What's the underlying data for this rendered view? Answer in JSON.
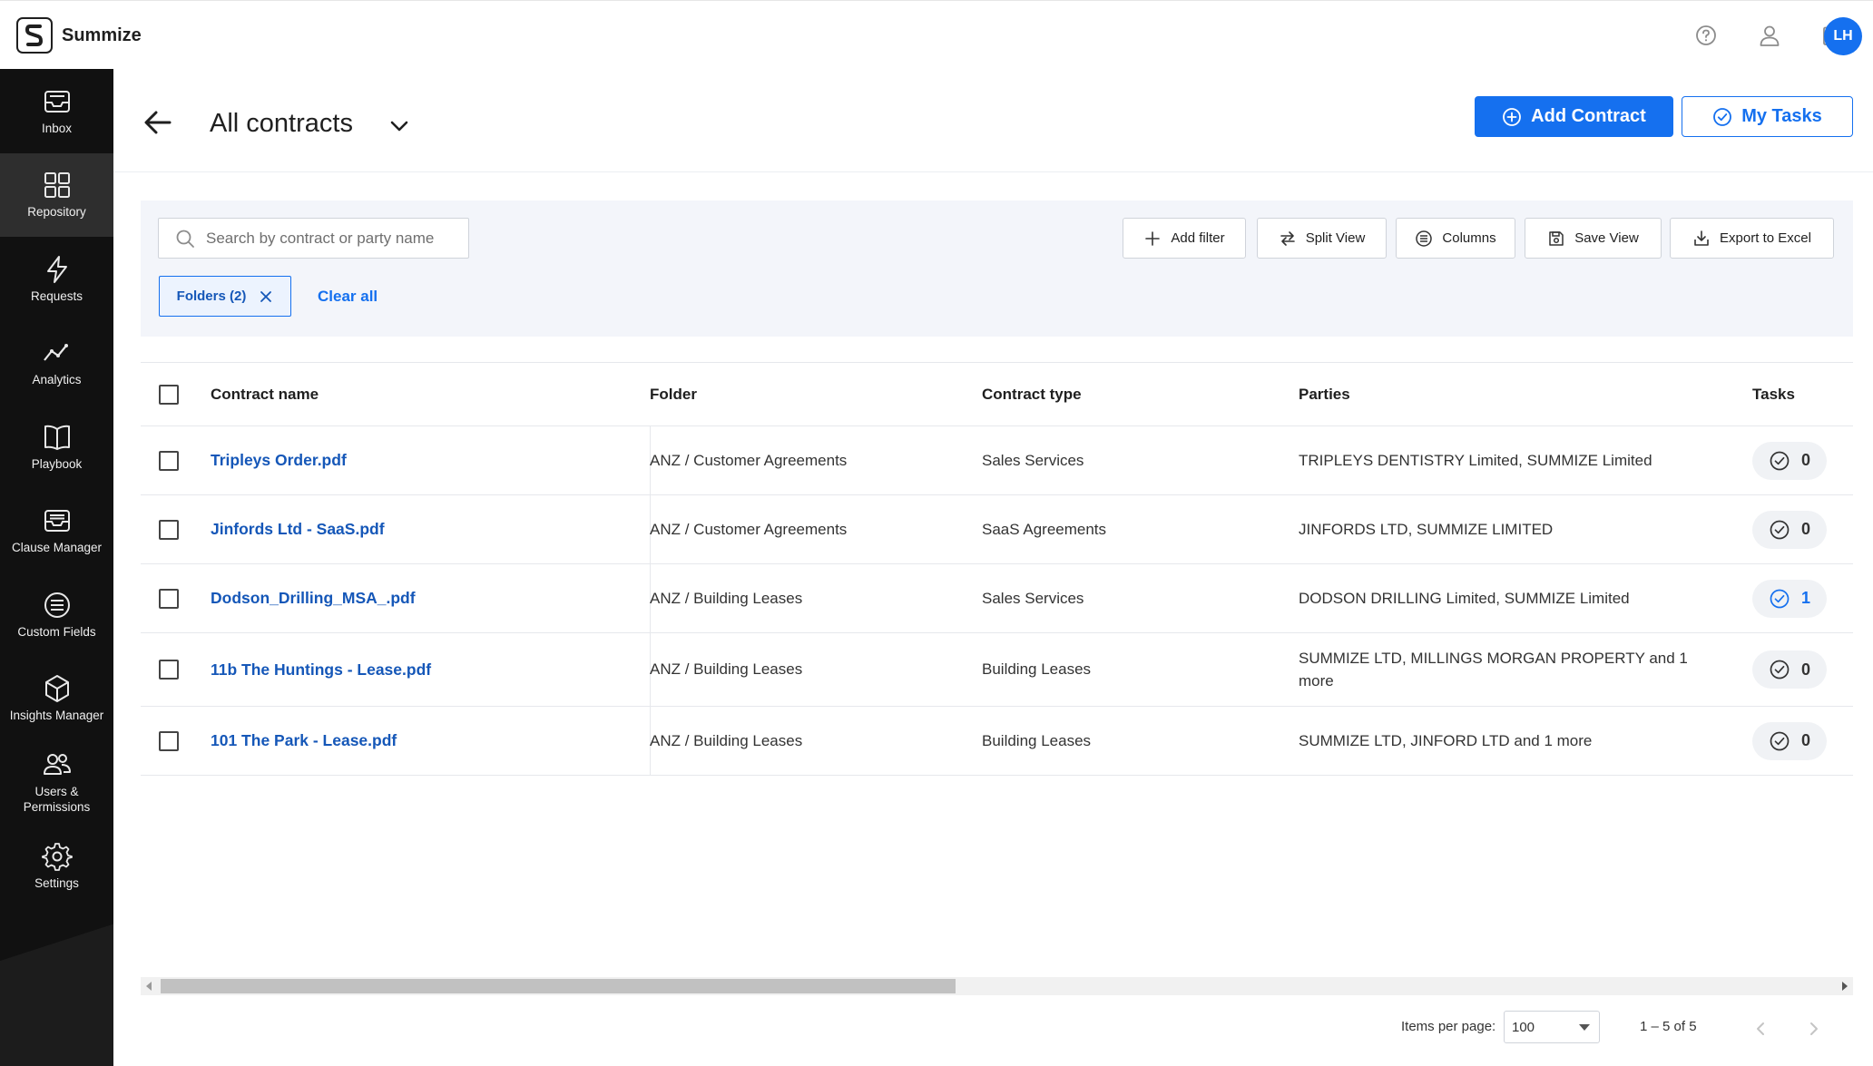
{
  "app": {
    "name": "Summize",
    "user_initials": "LH"
  },
  "top_icons": [
    "help-icon",
    "user-icon",
    "calendar-icon"
  ],
  "sidebar": {
    "items": [
      {
        "label": "Inbox",
        "icon": "inbox-icon"
      },
      {
        "label": "Repository",
        "icon": "grid-icon"
      },
      {
        "label": "Requests",
        "icon": "lightning-icon"
      },
      {
        "label": "Analytics",
        "icon": "trend-icon"
      },
      {
        "label": "Playbook",
        "icon": "book-icon"
      },
      {
        "label": "Clause Manager",
        "icon": "tray-icon"
      },
      {
        "label": "Custom Fields",
        "icon": "list-circle-icon"
      },
      {
        "label": "Insights Manager",
        "icon": "cube-icon"
      },
      {
        "label": "Users &\nPermissions",
        "icon": "users-icon"
      },
      {
        "label": "Settings",
        "icon": "gear-icon"
      }
    ],
    "active": "Repository"
  },
  "header": {
    "title": "All contracts",
    "add_contract_label": "Add Contract",
    "my_tasks_label": "My Tasks"
  },
  "filters": {
    "search_placeholder": "Search by contract or party name",
    "search_value": "",
    "buttons": {
      "add_filter": "Add filter",
      "split_view": "Split View",
      "columns": "Columns",
      "save_view": "Save View",
      "export": "Export to Excel"
    },
    "chip_label": "Folders (2)",
    "clear_all_label": "Clear all"
  },
  "table": {
    "headers": {
      "name": "Contract name",
      "folder": "Folder",
      "type": "Contract type",
      "parties": "Parties",
      "tasks": "Tasks"
    },
    "rows": [
      {
        "name": "Tripleys Order.pdf",
        "folder": "ANZ / Customer Agreements",
        "type": "Sales Services",
        "parties": "TRIPLEYS DENTISTRY Limited, SUMMIZE Limited",
        "tasks": "0"
      },
      {
        "name": "Jinfords Ltd - SaaS.pdf",
        "folder": "ANZ / Customer Agreements",
        "type": "SaaS Agreements",
        "parties": "JINFORDS LTD, SUMMIZE LIMITED",
        "tasks": "0"
      },
      {
        "name": "Dodson_Drilling_MSA_.pdf",
        "folder": "ANZ / Building Leases",
        "type": "Sales Services",
        "parties": "DODSON DRILLING Limited, SUMMIZE Limited",
        "tasks": "1"
      },
      {
        "name": "11b The Huntings - Lease.pdf",
        "folder": "ANZ / Building Leases",
        "type": "Building Leases",
        "parties": "SUMMIZE LTD, MILLINGS MORGAN PROPERTY and 1 more",
        "tasks": "0"
      },
      {
        "name": "101 The Park - Lease.pdf",
        "folder": "ANZ / Building Leases",
        "type": "Building Leases",
        "parties": "SUMMIZE LTD, JINFORD LTD and 1 more",
        "tasks": "0"
      }
    ]
  },
  "pagination": {
    "items_per_page_label": "Items per page:",
    "items_per_page_value": "100",
    "range_label": "1 – 5 of 5"
  },
  "colors": {
    "accent": "#1570ef",
    "sidebar_bg": "#111111",
    "link": "#1557b8"
  }
}
